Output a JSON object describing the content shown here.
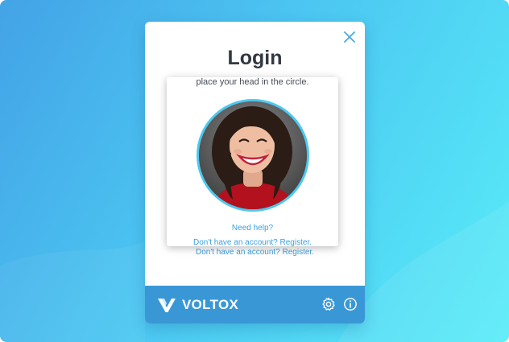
{
  "dialog": {
    "title": "Login",
    "close_icon": "close-icon",
    "register_link": "Don't have an account? Register."
  },
  "face_popup": {
    "instruction": "place your head in the circle.",
    "need_help": "Need help?",
    "register_link": "Don't have an account? Register."
  },
  "footer": {
    "brand": "VOLTOX",
    "settings_icon": "gear-icon",
    "info_icon": "info-icon"
  },
  "colors": {
    "accent": "#3a97d6",
    "link": "#3aa1de",
    "ring": "#4cc8f0",
    "title": "#333842"
  }
}
